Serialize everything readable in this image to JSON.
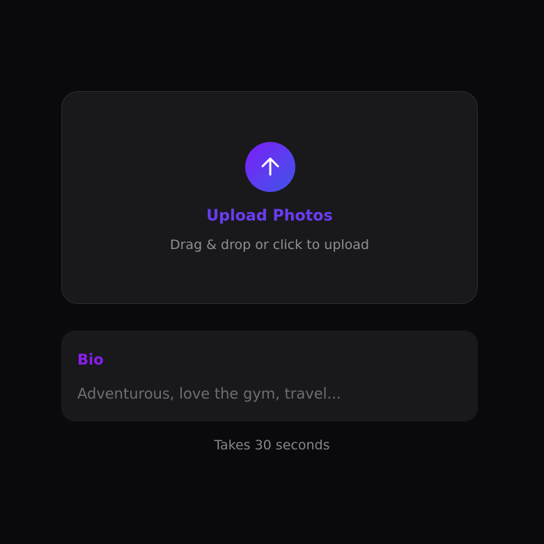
{
  "upload": {
    "icon": "arrow-up-icon",
    "title": "Upload Photos",
    "subtitle": "Drag & drop or click to upload"
  },
  "bio": {
    "label": "Bio",
    "placeholder": "Adventurous, love the gym, travel...",
    "value": ""
  },
  "footer": {
    "hint": "Takes 30 seconds"
  },
  "colors": {
    "background": "#0a0a0c",
    "card": "#19191c",
    "accent_purple": "#7b1cf5",
    "accent_blue": "#3f53e6",
    "title_purple": "#6b3cf2",
    "label_purple": "#8a1ef0",
    "muted_text": "#8e8e95"
  }
}
